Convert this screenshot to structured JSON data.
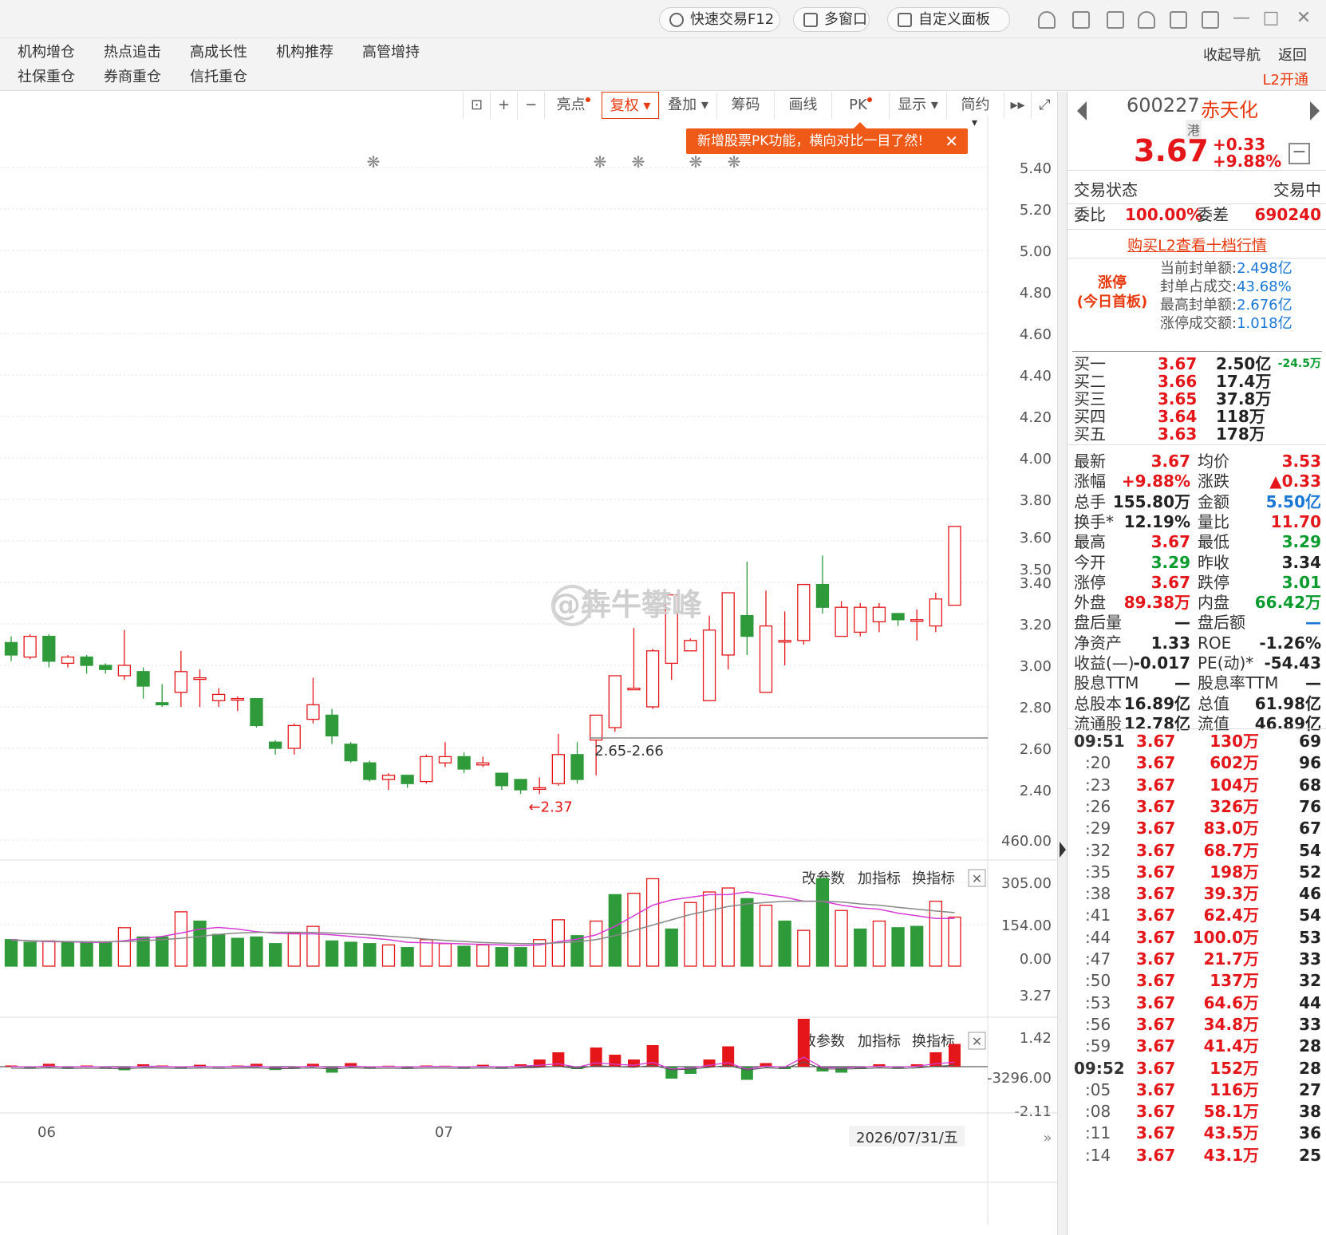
{
  "topbar": {
    "quick_trade": "快速交易F12",
    "multi_window": "多窗口",
    "custom_panel": "自定义面板"
  },
  "menu": {
    "row1": [
      "机构增仓",
      "热点追击",
      "高成长性",
      "机构推荐",
      "高管增持"
    ],
    "row2": [
      "社保重仓",
      "券商重仓",
      "信托重仓"
    ],
    "collapse_nav": "收起导航",
    "back": "返回",
    "l2_open": "L2开通"
  },
  "toolbar": {
    "highlight": "亮点",
    "fuquan": "复权",
    "overlay": "叠加",
    "chips": "筹码",
    "draw": "画线",
    "pk": "PK",
    "display": "显示",
    "simple": "简约"
  },
  "tooltip": "新增股票PK功能，横向对比一目了然!",
  "stock": {
    "code": "600227",
    "name": "赤天化",
    "tag": "港",
    "price": "3.67",
    "change": "+0.33",
    "change_pct": "+9.88%",
    "trade_status_label": "交易状态",
    "trade_status": "交易中",
    "weibi_label": "委比",
    "weibi": "100.00%",
    "weicha_label": "委差",
    "weicha": "690240",
    "buy_l2": "购买L2查看十档行情",
    "limit_title": "涨停",
    "limit_sub": "(今日首板)",
    "seal": [
      {
        "label": "当前封单额:",
        "value": "2.498亿"
      },
      {
        "label": "封单占成交:",
        "value": "43.68%"
      },
      {
        "label": "最高封单额:",
        "value": "2.676亿"
      },
      {
        "label": "涨停成交额:",
        "value": "1.018亿"
      }
    ],
    "orderbook": [
      {
        "label": "买一",
        "price": "3.67",
        "vol": "2.50亿",
        "delta": "-24.5万"
      },
      {
        "label": "买二",
        "price": "3.66",
        "vol": "17.4万"
      },
      {
        "label": "买三",
        "price": "3.65",
        "vol": "37.8万"
      },
      {
        "label": "买四",
        "price": "3.64",
        "vol": "118万"
      },
      {
        "label": "买五",
        "price": "3.63",
        "vol": "178万"
      }
    ],
    "stats": [
      {
        "l1": "最新",
        "v1": "3.67",
        "c1": "red",
        "l2": "均价",
        "v2": "3.53",
        "c2": "red"
      },
      {
        "l1": "涨幅",
        "v1": "+9.88%",
        "c1": "red",
        "l2": "涨跌",
        "v2": "▲0.33",
        "c2": "red"
      },
      {
        "l1": "总手",
        "v1": "155.80万",
        "c1": "dark",
        "l2": "金额",
        "v2": "5.50亿",
        "c2": "blue"
      },
      {
        "l1": "换手*",
        "v1": "12.19%",
        "c1": "dark",
        "l2": "量比",
        "v2": "11.70",
        "c2": "red"
      },
      {
        "l1": "最高",
        "v1": "3.67",
        "c1": "red",
        "l2": "最低",
        "v2": "3.29",
        "c2": "green"
      },
      {
        "l1": "今开",
        "v1": "3.29",
        "c1": "green",
        "l2": "昨收",
        "v2": "3.34",
        "c2": "dark"
      },
      {
        "l1": "涨停",
        "v1": "3.67",
        "c1": "red",
        "l2": "跌停",
        "v2": "3.01",
        "c2": "green"
      },
      {
        "l1": "外盘",
        "v1": "89.38万",
        "c1": "red",
        "l2": "内盘",
        "v2": "66.42万",
        "c2": "green"
      },
      {
        "l1": "盘后量",
        "v1": "—",
        "c1": "dark",
        "l2": "盘后额",
        "v2": "—",
        "c2": "blue"
      },
      {
        "l1": "净资产",
        "v1": "1.33",
        "c1": "dark",
        "l2": "ROE",
        "v2": "-1.26%",
        "c2": "dark"
      },
      {
        "l1": "收益(—)",
        "v1": "-0.017",
        "c1": "dark",
        "l2": "PE(动)*",
        "v2": "-54.43",
        "c2": "dark"
      },
      {
        "l1": "股息TTM",
        "v1": "—",
        "c1": "dark",
        "l2": "股息率TTM",
        "v2": "—",
        "c2": "dark"
      },
      {
        "l1": "总股本",
        "v1": "16.89亿",
        "c1": "dark",
        "l2": "总值",
        "v2": "61.98亿",
        "c2": "dark"
      },
      {
        "l1": "流通股",
        "v1": "12.78亿",
        "c1": "dark",
        "l2": "流值",
        "v2": "46.89亿",
        "c2": "dark"
      }
    ],
    "ticks": [
      [
        "09:51",
        "3.67",
        "130万",
        "69"
      ],
      [
        ":20",
        "3.67",
        "602万",
        "96"
      ],
      [
        ":23",
        "3.67",
        "104万",
        "68"
      ],
      [
        ":26",
        "3.67",
        "326万",
        "76"
      ],
      [
        ":29",
        "3.67",
        "83.0万",
        "67"
      ],
      [
        ":32",
        "3.67",
        "68.7万",
        "54"
      ],
      [
        ":35",
        "3.67",
        "198万",
        "52"
      ],
      [
        ":38",
        "3.67",
        "39.3万",
        "46"
      ],
      [
        ":41",
        "3.67",
        "62.4万",
        "54"
      ],
      [
        ":44",
        "3.67",
        "100.0万",
        "53"
      ],
      [
        ":47",
        "3.67",
        "21.7万",
        "33"
      ],
      [
        ":50",
        "3.67",
        "137万",
        "32"
      ],
      [
        ":53",
        "3.67",
        "64.6万",
        "44"
      ],
      [
        ":56",
        "3.67",
        "34.8万",
        "33"
      ],
      [
        ":59",
        "3.67",
        "41.4万",
        "28"
      ],
      [
        "09:52",
        "3.67",
        "152万",
        "28"
      ],
      [
        ":05",
        "3.67",
        "116万",
        "27"
      ],
      [
        ":08",
        "3.67",
        "58.1万",
        "38"
      ],
      [
        ":11",
        "3.67",
        "43.5万",
        "36"
      ],
      [
        ":14",
        "3.67",
        "43.1万",
        "25"
      ]
    ]
  },
  "subpanel": {
    "edit_params": "改参数",
    "add_indicator": "加指标",
    "swap_indicator": "换指标"
  },
  "chart_data": {
    "type": "candlestick",
    "price_axis": [
      "5.40",
      "5.20",
      "5.00",
      "4.80",
      "4.60",
      "4.40",
      "4.20",
      "4.00",
      "3.80",
      "3.60",
      "3.50",
      "3.40",
      "3.20",
      "3.00",
      "2.80",
      "2.60",
      "2.40"
    ],
    "price_ylim": [
      2.32,
      5.45
    ],
    "annotations": {
      "low_label": "2.37",
      "gap_label": "2.65-2.66",
      "watermark": "@犇牛攀峰"
    },
    "candles": [
      [
        3.11,
        3.05,
        3.14,
        3.02
      ],
      [
        3.04,
        3.14,
        3.15,
        3.03
      ],
      [
        3.14,
        3.02,
        3.15,
        2.99
      ],
      [
        3.01,
        3.04,
        3.05,
        2.99
      ],
      [
        3.04,
        3.0,
        3.05,
        2.96
      ],
      [
        3.0,
        2.98,
        3.01,
        2.96
      ],
      [
        2.95,
        3.0,
        3.17,
        2.93
      ],
      [
        2.97,
        2.9,
        2.99,
        2.84
      ],
      [
        2.82,
        2.81,
        2.91,
        2.8
      ],
      [
        2.87,
        2.97,
        3.07,
        2.8
      ],
      [
        2.94,
        2.94,
        2.98,
        2.8
      ],
      [
        2.83,
        2.86,
        2.89,
        2.8
      ],
      [
        2.84,
        2.84,
        2.85,
        2.78
      ],
      [
        2.84,
        2.71,
        2.84,
        2.7
      ],
      [
        2.63,
        2.6,
        2.64,
        2.57
      ],
      [
        2.6,
        2.71,
        2.72,
        2.57
      ],
      [
        2.74,
        2.81,
        2.94,
        2.72
      ],
      [
        2.76,
        2.66,
        2.79,
        2.62
      ],
      [
        2.62,
        2.54,
        2.63,
        2.53
      ],
      [
        2.53,
        2.45,
        2.54,
        2.44
      ],
      [
        2.45,
        2.47,
        2.48,
        2.4
      ],
      [
        2.47,
        2.43,
        2.47,
        2.41
      ],
      [
        2.44,
        2.56,
        2.57,
        2.43
      ],
      [
        2.53,
        2.56,
        2.63,
        2.51
      ],
      [
        2.56,
        2.5,
        2.58,
        2.48
      ],
      [
        2.52,
        2.53,
        2.56,
        2.51
      ],
      [
        2.48,
        2.42,
        2.48,
        2.4
      ],
      [
        2.45,
        2.4,
        2.45,
        2.38
      ],
      [
        2.41,
        2.41,
        2.46,
        2.38
      ],
      [
        2.43,
        2.57,
        2.67,
        2.42
      ],
      [
        2.57,
        2.45,
        2.63,
        2.43
      ],
      [
        2.64,
        2.76,
        2.76,
        2.47
      ],
      [
        2.7,
        2.95,
        2.95,
        2.68
      ],
      [
        2.89,
        2.89,
        3.18,
        2.89
      ],
      [
        2.8,
        3.07,
        3.08,
        2.79
      ],
      [
        3.01,
        3.34,
        3.34,
        2.93
      ],
      [
        3.07,
        3.12,
        3.13,
        3.07
      ],
      [
        2.83,
        3.17,
        3.24,
        2.83
      ],
      [
        3.05,
        3.35,
        3.35,
        2.98
      ],
      [
        3.24,
        3.14,
        3.5,
        3.05
      ],
      [
        2.87,
        3.19,
        3.36,
        2.87
      ],
      [
        3.12,
        3.12,
        3.26,
        3.0
      ],
      [
        3.12,
        3.39,
        3.39,
        3.1
      ],
      [
        3.39,
        3.28,
        3.53,
        3.25
      ],
      [
        3.14,
        3.28,
        3.31,
        3.14
      ],
      [
        3.16,
        3.28,
        3.3,
        3.14
      ],
      [
        3.21,
        3.28,
        3.3,
        3.16
      ],
      [
        3.25,
        3.22,
        3.25,
        3.19
      ],
      [
        3.22,
        3.22,
        3.27,
        3.12
      ],
      [
        3.19,
        3.32,
        3.35,
        3.16
      ],
      [
        3.29,
        3.67,
        3.67,
        3.29
      ]
    ],
    "ma_flat_line": 2.65,
    "volume": {
      "axis": [
        "460.00",
        "305.00",
        "154.00",
        "0.00"
      ],
      "ymax": 470,
      "bars": [
        [
          70,
          "d"
        ],
        [
          60,
          "d"
        ],
        [
          65,
          "u"
        ],
        [
          60,
          "d"
        ],
        [
          60,
          "d"
        ],
        [
          60,
          "d"
        ],
        [
          115,
          "u"
        ],
        [
          80,
          "d"
        ],
        [
          80,
          "d"
        ],
        [
          175,
          "u"
        ],
        [
          140,
          "d"
        ],
        [
          90,
          "d"
        ],
        [
          75,
          "d"
        ],
        [
          80,
          "d"
        ],
        [
          55,
          "d"
        ],
        [
          95,
          "u"
        ],
        [
          120,
          "u"
        ],
        [
          65,
          "d"
        ],
        [
          60,
          "d"
        ],
        [
          55,
          "d"
        ],
        [
          50,
          "u"
        ],
        [
          40,
          "d"
        ],
        [
          70,
          "u"
        ],
        [
          55,
          "u"
        ],
        [
          45,
          "d"
        ],
        [
          50,
          "u"
        ],
        [
          40,
          "d"
        ],
        [
          40,
          "d"
        ],
        [
          70,
          "u"
        ],
        [
          145,
          "u"
        ],
        [
          85,
          "d"
        ],
        [
          140,
          "u"
        ],
        [
          240,
          "d"
        ],
        [
          245,
          "u"
        ],
        [
          300,
          "u"
        ],
        [
          110,
          "d"
        ],
        [
          210,
          "u"
        ],
        [
          250,
          "u"
        ],
        [
          265,
          "u"
        ],
        [
          225,
          "d"
        ],
        [
          200,
          "u"
        ],
        [
          140,
          "d"
        ],
        [
          105,
          "u"
        ],
        [
          300,
          "d"
        ],
        [
          180,
          "u"
        ],
        [
          110,
          "d"
        ],
        [
          140,
          "u"
        ],
        [
          115,
          "d"
        ],
        [
          120,
          "d"
        ],
        [
          215,
          "u"
        ],
        [
          155,
          "u"
        ]
      ],
      "ma_a": [
        70,
        65,
        62,
        62,
        60,
        60,
        66,
        75,
        82,
        95,
        110,
        116,
        110,
        100,
        94,
        92,
        92,
        88,
        82,
        76,
        70,
        60,
        58,
        56,
        54,
        52,
        50,
        48,
        50,
        62,
        72,
        88,
        120,
        160,
        200,
        220,
        230,
        240,
        240,
        250,
        240,
        230,
        215,
        215,
        200,
        190,
        185,
        170,
        160,
        150,
        150
      ],
      "ma_b": [
        68,
        66,
        64,
        63,
        62,
        62,
        63,
        66,
        70,
        75,
        82,
        90,
        95,
        97,
        98,
        98,
        97,
        95,
        92,
        88,
        83,
        78,
        72,
        67,
        63,
        59,
        57,
        55,
        55,
        58,
        62,
        70,
        85,
        105,
        125,
        145,
        165,
        180,
        195,
        205,
        210,
        215,
        215,
        215,
        212,
        205,
        200,
        192,
        185,
        178,
        172
      ]
    },
    "macd": {
      "axis": [
        "3.27",
        "1.42",
        "-3296.00",
        "-2.11"
      ],
      "bars": [
        0.05,
        -0.06,
        0.12,
        -0.08,
        0.05,
        -0.06,
        -0.15,
        0.1,
        0.05,
        -0.05,
        0.08,
        -0.04,
        0.05,
        0.12,
        -0.14,
        -0.08,
        0.12,
        -0.25,
        0.15,
        -0.05,
        0.04,
        -0.08,
        0.05,
        0.04,
        -0.05,
        0.08,
        -0.05,
        0.1,
        0.3,
        0.6,
        -0.1,
        0.8,
        0.5,
        0.3,
        0.9,
        -0.5,
        -0.3,
        0.3,
        0.85,
        -0.55,
        0.15,
        -0.1,
        2.0,
        -0.2,
        -0.25,
        -0.1,
        0.1,
        -0.08,
        0.1,
        0.6,
        0.95
      ]
    },
    "x_labels": [
      "06",
      "07"
    ],
    "date_label": "2026/07/31/五"
  }
}
